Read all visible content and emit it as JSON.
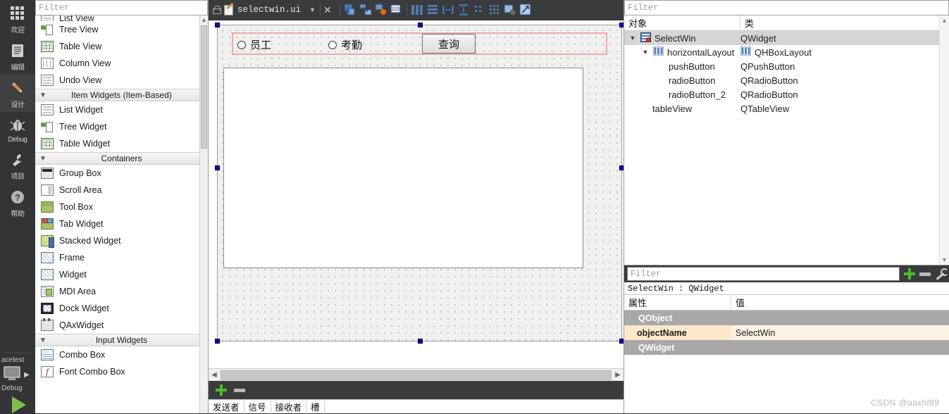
{
  "modebar": {
    "items": [
      {
        "label": "欢迎",
        "icon": "grid-icon",
        "active": false
      },
      {
        "label": "编辑",
        "icon": "document-icon",
        "active": false
      },
      {
        "label": "设计",
        "icon": "pencil-icon",
        "active": true
      },
      {
        "label": "Debug",
        "icon": "bug-icon",
        "active": false
      },
      {
        "label": "项目",
        "icon": "wrench-icon",
        "active": false
      },
      {
        "label": "帮助",
        "icon": "question-mark-icon",
        "active": false
      }
    ],
    "kit_name": "acetest",
    "build_config": "Debug",
    "run_icon": "run-triangle-icon",
    "target_icon": "desktop-monitor-icon"
  },
  "widgetbox": {
    "filter_placeholder": "Filter",
    "items": [
      {
        "type": "item",
        "label": "List View",
        "icon": "list-view-icon",
        "clipped": true
      },
      {
        "type": "item",
        "label": "Tree View",
        "icon": "tree-view-icon"
      },
      {
        "type": "item",
        "label": "Table View",
        "icon": "table-view-icon"
      },
      {
        "type": "item",
        "label": "Column View",
        "icon": "column-view-icon"
      },
      {
        "type": "item",
        "label": "Undo View",
        "icon": "undo-view-icon"
      },
      {
        "type": "group",
        "label": "Item Widgets (Item-Based)",
        "expanded": true
      },
      {
        "type": "item",
        "label": "List Widget",
        "icon": "list-widget-icon"
      },
      {
        "type": "item",
        "label": "Tree Widget",
        "icon": "tree-widget-icon"
      },
      {
        "type": "item",
        "label": "Table Widget",
        "icon": "table-widget-icon"
      },
      {
        "type": "group",
        "label": "Containers",
        "expanded": true
      },
      {
        "type": "item",
        "label": "Group Box",
        "icon": "group-box-icon"
      },
      {
        "type": "item",
        "label": "Scroll Area",
        "icon": "scroll-area-icon"
      },
      {
        "type": "item",
        "label": "Tool Box",
        "icon": "tool-box-icon"
      },
      {
        "type": "item",
        "label": "Tab Widget",
        "icon": "tab-widget-icon"
      },
      {
        "type": "item",
        "label": "Stacked Widget",
        "icon": "stacked-widget-icon"
      },
      {
        "type": "item",
        "label": "Frame",
        "icon": "frame-icon"
      },
      {
        "type": "item",
        "label": "Widget",
        "icon": "widget-icon"
      },
      {
        "type": "item",
        "label": "MDI Area",
        "icon": "mdi-area-icon"
      },
      {
        "type": "item",
        "label": "Dock Widget",
        "icon": "dock-widget-icon"
      },
      {
        "type": "item",
        "label": "QAxWidget",
        "icon": "qax-widget-icon"
      },
      {
        "type": "group",
        "label": "Input Widgets",
        "expanded": true
      },
      {
        "type": "item",
        "label": "Combo Box",
        "icon": "combo-box-icon"
      },
      {
        "type": "item",
        "label": "Font Combo Box",
        "icon": "font-combo-box-icon"
      }
    ]
  },
  "tab": {
    "filename": "selectwin.ui",
    "lock_icon": "unlocked-padlock-icon",
    "file_icon": "ui-file-icon",
    "dropdown_icon": "chevron-down-icon",
    "close_icon": "close-icon"
  },
  "designer_toolbar": {
    "buttons": [
      {
        "name": "edit-widgets-button",
        "icon": "edit-widgets-icon"
      },
      {
        "name": "edit-signals-slots-button",
        "icon": "signals-slots-icon"
      },
      {
        "name": "edit-buddies-button",
        "icon": "buddies-icon"
      },
      {
        "name": "edit-tab-order-button",
        "icon": "tab-order-icon"
      },
      {
        "name": "layout-horizontally-button",
        "icon": "layout-horizontal-icon"
      },
      {
        "name": "layout-vertically-button",
        "icon": "layout-vertical-icon"
      },
      {
        "name": "layout-splitter-horizontal-button",
        "icon": "splitter-horizontal-icon"
      },
      {
        "name": "layout-splitter-vertical-button",
        "icon": "splitter-vertical-icon"
      },
      {
        "name": "layout-form-button",
        "icon": "form-layout-icon"
      },
      {
        "name": "layout-grid-button",
        "icon": "grid-layout-icon"
      },
      {
        "name": "break-layout-button",
        "icon": "break-layout-icon"
      },
      {
        "name": "adjust-size-button",
        "icon": "adjust-size-icon"
      }
    ]
  },
  "form": {
    "radio1_label": "员工",
    "radio2_label": "考勤",
    "pushbutton_label": "查询",
    "layout_border_color": "#f3a6a6",
    "selection_handle_color": "#0a0acc"
  },
  "object_inspector": {
    "filter_placeholder": "Filter",
    "columns": [
      "对象",
      "类"
    ],
    "rows": [
      {
        "name": "SelectWin",
        "class": "QWidget",
        "indent": 0,
        "chevron": "v",
        "icon": "qwidget-icon",
        "selected": true
      },
      {
        "name": "horizontalLayout",
        "class": "QHBoxLayout",
        "indent": 1,
        "chevron": "v",
        "icon": "hboxlayout-icon",
        "class_icon": "hboxlayout-icon"
      },
      {
        "name": "pushButton",
        "class": "QPushButton",
        "indent": 2,
        "chevron": "",
        "icon": ""
      },
      {
        "name": "radioButton",
        "class": "QRadioButton",
        "indent": 2,
        "chevron": "",
        "icon": ""
      },
      {
        "name": "radioButton_2",
        "class": "QRadioButton",
        "indent": 2,
        "chevron": "",
        "icon": ""
      },
      {
        "name": "tableView",
        "class": "QTableView",
        "indent": 1,
        "chevron": "",
        "icon": ""
      }
    ]
  },
  "property_editor": {
    "filter_placeholder": "Filter",
    "add_icon": "plus-icon",
    "remove_icon": "minus-icon",
    "configure_icon": "wrench-icon",
    "selected_object": "SelectWin : QWidget",
    "columns": [
      "属性",
      "值"
    ],
    "rows": [
      {
        "kind": "group",
        "name": "QObject",
        "chevron": "v"
      },
      {
        "kind": "value",
        "name": "objectName",
        "value": "SelectWin"
      },
      {
        "kind": "group",
        "name": "QWidget",
        "chevron": ">"
      }
    ]
  },
  "signal_slot_editor": {
    "add_icon": "plus-icon",
    "remove_icon": "minus-icon",
    "columns": [
      "发送者",
      "信号",
      "接收者",
      "槽"
    ]
  },
  "watermark": "CSDN @aaxhl99"
}
